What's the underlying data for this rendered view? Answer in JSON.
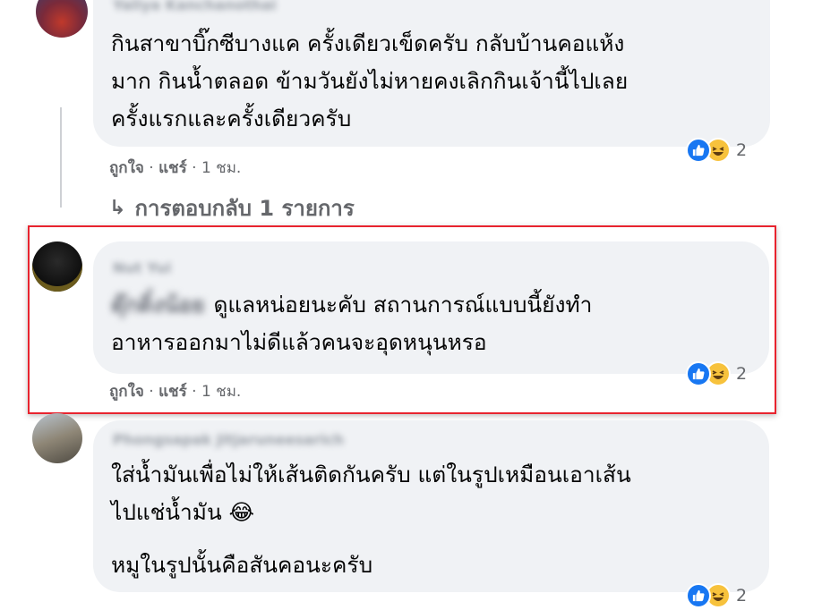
{
  "comments": [
    {
      "author": "Yaliya Kanchanothai",
      "lines": [
        "กินสาขาบิ๊กซีบางแค ครั้งเดียวเข็ดครับ กลับบ้านคอแห้ง",
        "มาก กินน้ำตลอด ข้ามวันยังไม่หายคงเลิกกินเจ้านี้ไปเลย",
        "ครั้งแรกและครั้งเดียวครับ"
      ],
      "like_label": "ถูกใจ",
      "share_label": "แชร์",
      "time": "1 ชม.",
      "reaction_count": "2",
      "reply_link": "การตอบกลับ 1 รายการ"
    },
    {
      "author": "Nut Yui",
      "tag": "ดุ๊กดิ๋งน้อย",
      "lines": [
        "ดูแลหน่อยนะคับ สถานการณ์แบบนี้ยังทำ",
        "อาหารออกมาไม่ดีแล้วคนจะอุดหนุนหรอ"
      ],
      "like_label": "ถูกใจ",
      "share_label": "แชร์",
      "time": "1 ชม.",
      "reaction_count": "2"
    },
    {
      "author": "Phongsapak Jitjaruneesarich",
      "lines": [
        "ใส่น้ำมันเพื่อไม่ให้เส้นติดกันครับ แต่ในรูปเหมือนเอาเส้น",
        "ไปแช่น้ำมัน 😂",
        "หมูในรูปนั้นคือสันคอนะครับ"
      ],
      "reaction_count": "2"
    }
  ],
  "colors": {
    "bubble": "#f0f2f5",
    "meta": "#65676b",
    "highlight": "#e8242f",
    "like": "#1877f2",
    "haha": "#f7c23c"
  },
  "icons": {
    "reply_arrow": "reply-arrow-icon",
    "like": "like-reaction-icon",
    "haha": "haha-reaction-icon"
  }
}
